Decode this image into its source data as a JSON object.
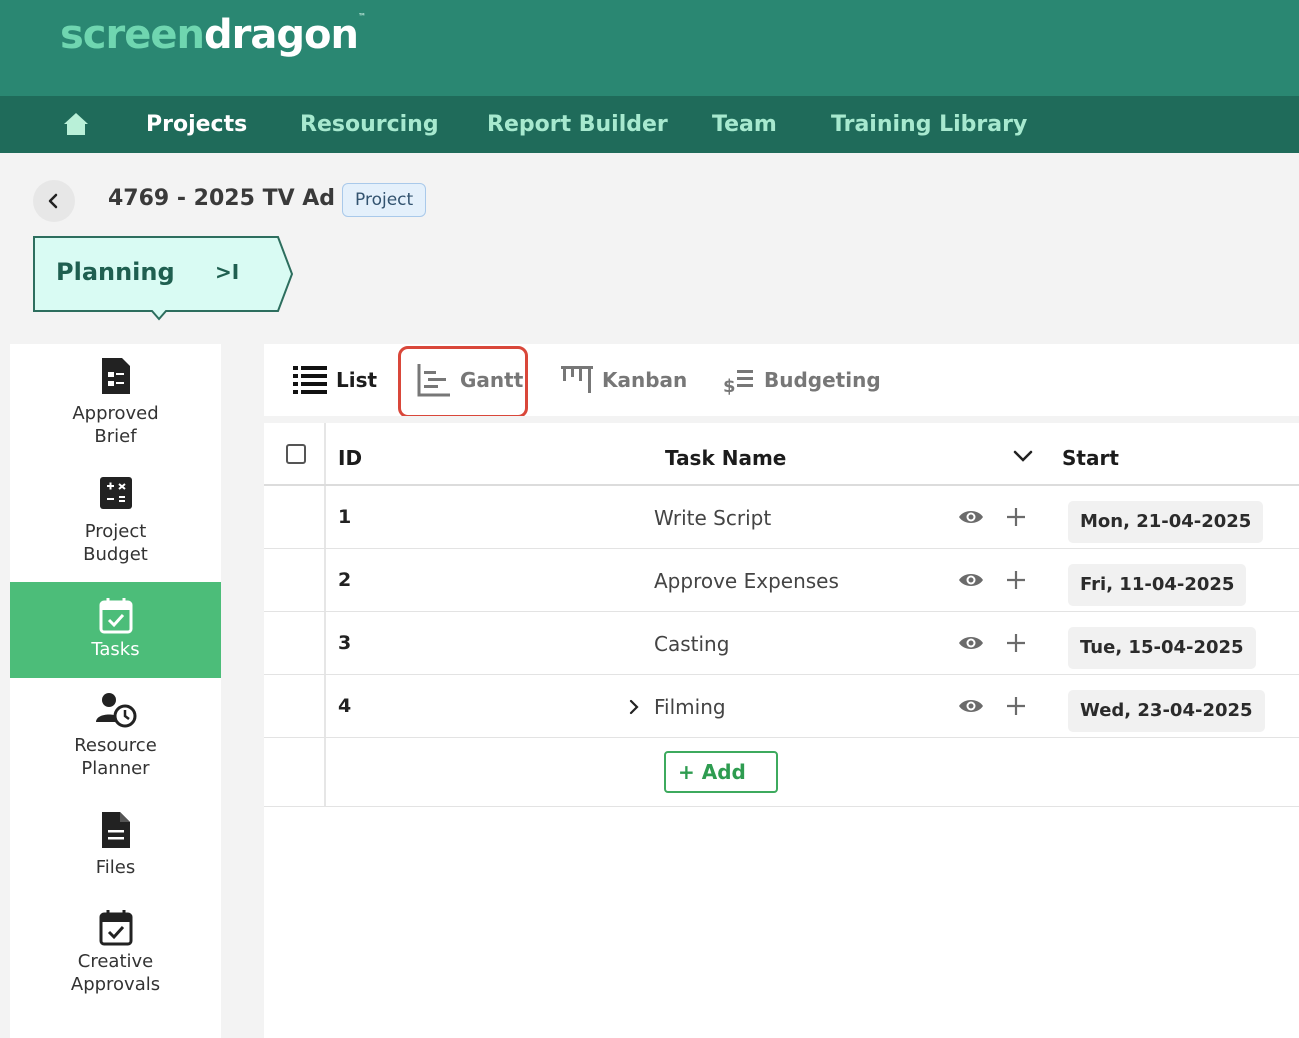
{
  "header": {
    "logo_part1": "screen",
    "logo_part2": "dragon",
    "logo_mark": "™",
    "brand_color": "#2a8772"
  },
  "nav": {
    "home_icon": "home-icon",
    "items": [
      {
        "label": "Projects",
        "active": true
      },
      {
        "label": "Resourcing"
      },
      {
        "label": "Report Builder"
      },
      {
        "label": "Team"
      },
      {
        "label": "Training Library"
      }
    ]
  },
  "breadcrumb": {
    "back_icon": "chevron-left-icon",
    "title": "4769 - 2025 TV Ad",
    "badge": "Project"
  },
  "stage": {
    "label": "Planning",
    "skip_icon": ">I"
  },
  "sidebar": {
    "items": [
      {
        "label": "Approved\nBrief",
        "icon": "brief-icon"
      },
      {
        "label": "Project\nBudget",
        "icon": "calculator-icon"
      },
      {
        "label": "Tasks",
        "icon": "calendar-check-icon",
        "active": true
      },
      {
        "label": "Resource\nPlanner",
        "icon": "user-clock-icon"
      },
      {
        "label": "Files",
        "icon": "file-icon"
      },
      {
        "label": "Creative\nApprovals",
        "icon": "calendar-check-icon"
      }
    ]
  },
  "tabs": [
    {
      "label": "List",
      "icon": "list-icon",
      "active": true
    },
    {
      "label": "Gantt",
      "icon": "gantt-icon",
      "highlighted": true
    },
    {
      "label": "Kanban",
      "icon": "kanban-icon"
    },
    {
      "label": "Budgeting",
      "icon": "budget-icon"
    }
  ],
  "table": {
    "columns": {
      "id": "ID",
      "name": "Task Name",
      "start": "Start"
    },
    "rows": [
      {
        "id": "1",
        "name": "Write Script",
        "start": "Mon, 21-04-2025"
      },
      {
        "id": "2",
        "name": "Approve Expenses",
        "start": "Fri, 11-04-2025"
      },
      {
        "id": "3",
        "name": "Casting",
        "start": "Tue, 15-04-2025"
      },
      {
        "id": "4",
        "name": "Filming",
        "start": "Wed, 23-04-2025",
        "expandable": true
      }
    ],
    "add_label": "+ Add"
  },
  "colors": {
    "accent_green": "#4cbd79",
    "highlight_red": "#d9473a"
  }
}
